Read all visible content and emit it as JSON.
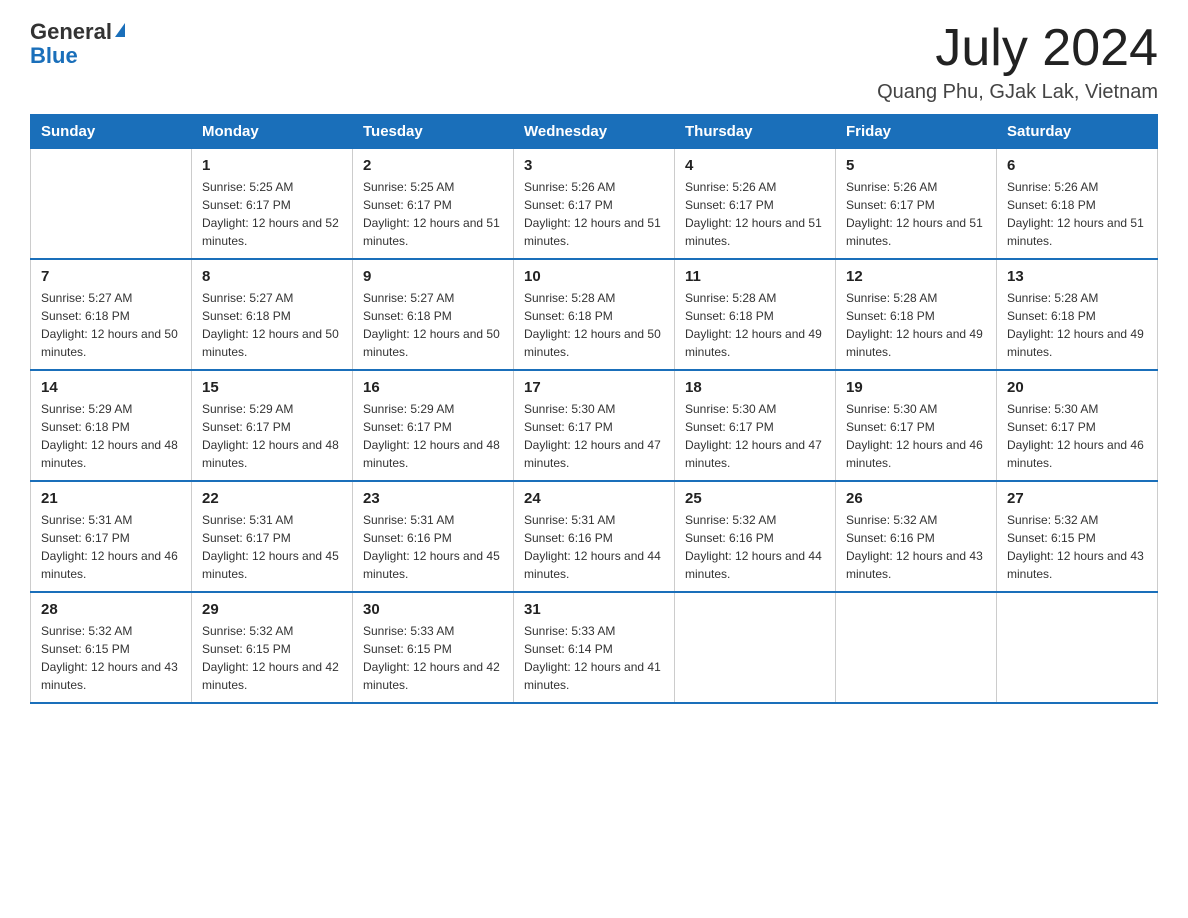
{
  "header": {
    "logo_general": "General",
    "logo_blue": "Blue",
    "month_title": "July 2024",
    "location": "Quang Phu, GJak Lak, Vietnam"
  },
  "weekdays": [
    "Sunday",
    "Monday",
    "Tuesday",
    "Wednesday",
    "Thursday",
    "Friday",
    "Saturday"
  ],
  "weeks": [
    [
      {
        "day": "",
        "sunrise": "",
        "sunset": "",
        "daylight": ""
      },
      {
        "day": "1",
        "sunrise": "Sunrise: 5:25 AM",
        "sunset": "Sunset: 6:17 PM",
        "daylight": "Daylight: 12 hours and 52 minutes."
      },
      {
        "day": "2",
        "sunrise": "Sunrise: 5:25 AM",
        "sunset": "Sunset: 6:17 PM",
        "daylight": "Daylight: 12 hours and 51 minutes."
      },
      {
        "day": "3",
        "sunrise": "Sunrise: 5:26 AM",
        "sunset": "Sunset: 6:17 PM",
        "daylight": "Daylight: 12 hours and 51 minutes."
      },
      {
        "day": "4",
        "sunrise": "Sunrise: 5:26 AM",
        "sunset": "Sunset: 6:17 PM",
        "daylight": "Daylight: 12 hours and 51 minutes."
      },
      {
        "day": "5",
        "sunrise": "Sunrise: 5:26 AM",
        "sunset": "Sunset: 6:17 PM",
        "daylight": "Daylight: 12 hours and 51 minutes."
      },
      {
        "day": "6",
        "sunrise": "Sunrise: 5:26 AM",
        "sunset": "Sunset: 6:18 PM",
        "daylight": "Daylight: 12 hours and 51 minutes."
      }
    ],
    [
      {
        "day": "7",
        "sunrise": "Sunrise: 5:27 AM",
        "sunset": "Sunset: 6:18 PM",
        "daylight": "Daylight: 12 hours and 50 minutes."
      },
      {
        "day": "8",
        "sunrise": "Sunrise: 5:27 AM",
        "sunset": "Sunset: 6:18 PM",
        "daylight": "Daylight: 12 hours and 50 minutes."
      },
      {
        "day": "9",
        "sunrise": "Sunrise: 5:27 AM",
        "sunset": "Sunset: 6:18 PM",
        "daylight": "Daylight: 12 hours and 50 minutes."
      },
      {
        "day": "10",
        "sunrise": "Sunrise: 5:28 AM",
        "sunset": "Sunset: 6:18 PM",
        "daylight": "Daylight: 12 hours and 50 minutes."
      },
      {
        "day": "11",
        "sunrise": "Sunrise: 5:28 AM",
        "sunset": "Sunset: 6:18 PM",
        "daylight": "Daylight: 12 hours and 49 minutes."
      },
      {
        "day": "12",
        "sunrise": "Sunrise: 5:28 AM",
        "sunset": "Sunset: 6:18 PM",
        "daylight": "Daylight: 12 hours and 49 minutes."
      },
      {
        "day": "13",
        "sunrise": "Sunrise: 5:28 AM",
        "sunset": "Sunset: 6:18 PM",
        "daylight": "Daylight: 12 hours and 49 minutes."
      }
    ],
    [
      {
        "day": "14",
        "sunrise": "Sunrise: 5:29 AM",
        "sunset": "Sunset: 6:18 PM",
        "daylight": "Daylight: 12 hours and 48 minutes."
      },
      {
        "day": "15",
        "sunrise": "Sunrise: 5:29 AM",
        "sunset": "Sunset: 6:17 PM",
        "daylight": "Daylight: 12 hours and 48 minutes."
      },
      {
        "day": "16",
        "sunrise": "Sunrise: 5:29 AM",
        "sunset": "Sunset: 6:17 PM",
        "daylight": "Daylight: 12 hours and 48 minutes."
      },
      {
        "day": "17",
        "sunrise": "Sunrise: 5:30 AM",
        "sunset": "Sunset: 6:17 PM",
        "daylight": "Daylight: 12 hours and 47 minutes."
      },
      {
        "day": "18",
        "sunrise": "Sunrise: 5:30 AM",
        "sunset": "Sunset: 6:17 PM",
        "daylight": "Daylight: 12 hours and 47 minutes."
      },
      {
        "day": "19",
        "sunrise": "Sunrise: 5:30 AM",
        "sunset": "Sunset: 6:17 PM",
        "daylight": "Daylight: 12 hours and 46 minutes."
      },
      {
        "day": "20",
        "sunrise": "Sunrise: 5:30 AM",
        "sunset": "Sunset: 6:17 PM",
        "daylight": "Daylight: 12 hours and 46 minutes."
      }
    ],
    [
      {
        "day": "21",
        "sunrise": "Sunrise: 5:31 AM",
        "sunset": "Sunset: 6:17 PM",
        "daylight": "Daylight: 12 hours and 46 minutes."
      },
      {
        "day": "22",
        "sunrise": "Sunrise: 5:31 AM",
        "sunset": "Sunset: 6:17 PM",
        "daylight": "Daylight: 12 hours and 45 minutes."
      },
      {
        "day": "23",
        "sunrise": "Sunrise: 5:31 AM",
        "sunset": "Sunset: 6:16 PM",
        "daylight": "Daylight: 12 hours and 45 minutes."
      },
      {
        "day": "24",
        "sunrise": "Sunrise: 5:31 AM",
        "sunset": "Sunset: 6:16 PM",
        "daylight": "Daylight: 12 hours and 44 minutes."
      },
      {
        "day": "25",
        "sunrise": "Sunrise: 5:32 AM",
        "sunset": "Sunset: 6:16 PM",
        "daylight": "Daylight: 12 hours and 44 minutes."
      },
      {
        "day": "26",
        "sunrise": "Sunrise: 5:32 AM",
        "sunset": "Sunset: 6:16 PM",
        "daylight": "Daylight: 12 hours and 43 minutes."
      },
      {
        "day": "27",
        "sunrise": "Sunrise: 5:32 AM",
        "sunset": "Sunset: 6:15 PM",
        "daylight": "Daylight: 12 hours and 43 minutes."
      }
    ],
    [
      {
        "day": "28",
        "sunrise": "Sunrise: 5:32 AM",
        "sunset": "Sunset: 6:15 PM",
        "daylight": "Daylight: 12 hours and 43 minutes."
      },
      {
        "day": "29",
        "sunrise": "Sunrise: 5:32 AM",
        "sunset": "Sunset: 6:15 PM",
        "daylight": "Daylight: 12 hours and 42 minutes."
      },
      {
        "day": "30",
        "sunrise": "Sunrise: 5:33 AM",
        "sunset": "Sunset: 6:15 PM",
        "daylight": "Daylight: 12 hours and 42 minutes."
      },
      {
        "day": "31",
        "sunrise": "Sunrise: 5:33 AM",
        "sunset": "Sunset: 6:14 PM",
        "daylight": "Daylight: 12 hours and 41 minutes."
      },
      {
        "day": "",
        "sunrise": "",
        "sunset": "",
        "daylight": ""
      },
      {
        "day": "",
        "sunrise": "",
        "sunset": "",
        "daylight": ""
      },
      {
        "day": "",
        "sunrise": "",
        "sunset": "",
        "daylight": ""
      }
    ]
  ]
}
